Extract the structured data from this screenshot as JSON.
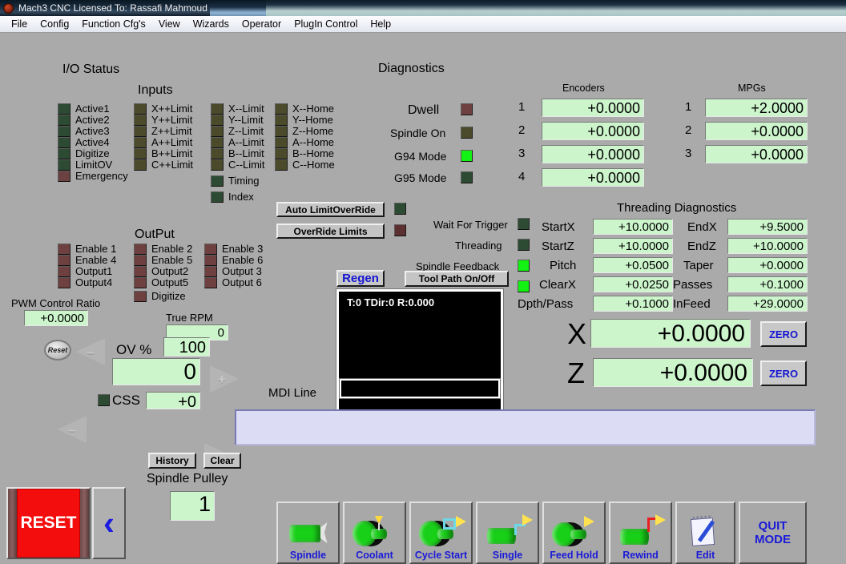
{
  "window": {
    "title": "Mach3 CNC  Licensed To: Rassafi Mahmoud",
    "icon": "mach3-logo-icon"
  },
  "menubar": {
    "items": [
      "File",
      "Config",
      "Function Cfg's",
      "View",
      "Wizards",
      "Operator",
      "PlugIn Control",
      "Help"
    ]
  },
  "io_status": {
    "title": "I/O Status",
    "inputs_title": "Inputs",
    "output_title": "OutPut",
    "inputs_col1": [
      {
        "label": "Active1",
        "state": "green-dark"
      },
      {
        "label": "Active2",
        "state": "green-dark"
      },
      {
        "label": "Active3",
        "state": "green-dark"
      },
      {
        "label": "Active4",
        "state": "green-dark"
      },
      {
        "label": "Digitize",
        "state": "green-dark"
      },
      {
        "label": "LimitOV",
        "state": "green-dark"
      },
      {
        "label": "Emergency",
        "state": "red-dark"
      }
    ],
    "inputs_col2": [
      {
        "label": "X++Limit",
        "state": "olive"
      },
      {
        "label": "Y++Limit",
        "state": "olive"
      },
      {
        "label": "Z++Limit",
        "state": "olive"
      },
      {
        "label": "A++Limit",
        "state": "olive"
      },
      {
        "label": "B++Limit",
        "state": "olive"
      },
      {
        "label": "C++Limit",
        "state": "olive"
      }
    ],
    "inputs_col3": [
      {
        "label": "X--Limit",
        "state": "olive"
      },
      {
        "label": "Y--Limit",
        "state": "olive"
      },
      {
        "label": "Z--Limit",
        "state": "olive"
      },
      {
        "label": "A--Limit",
        "state": "olive"
      },
      {
        "label": "B--Limit",
        "state": "olive"
      },
      {
        "label": "C--Limit",
        "state": "olive"
      }
    ],
    "inputs_col3_extra": [
      {
        "label": "Timing",
        "state": "green-dark"
      },
      {
        "label": "Index",
        "state": "green-dark"
      }
    ],
    "inputs_col4": [
      {
        "label": "X--Home",
        "state": "olive"
      },
      {
        "label": "Y--Home",
        "state": "olive"
      },
      {
        "label": "Z--Home",
        "state": "olive"
      },
      {
        "label": "A--Home",
        "state": "olive"
      },
      {
        "label": "B--Home",
        "state": "olive"
      },
      {
        "label": "C--Home",
        "state": "olive"
      }
    ],
    "output_col1": [
      {
        "label": "Enable 1",
        "state": "maroon"
      },
      {
        "label": "Enable 4",
        "state": "maroon"
      },
      {
        "label": "Output1",
        "state": "maroon"
      },
      {
        "label": "Output4",
        "state": "maroon"
      }
    ],
    "output_col2": [
      {
        "label": "Enable 2",
        "state": "maroon"
      },
      {
        "label": "Enable 5",
        "state": "maroon"
      },
      {
        "label": "Output2",
        "state": "maroon"
      },
      {
        "label": "Output5",
        "state": "maroon"
      },
      {
        "label": "Digitize",
        "state": "maroon"
      }
    ],
    "output_col3": [
      {
        "label": "Enable 3",
        "state": "maroon"
      },
      {
        "label": "Enable 6",
        "state": "maroon"
      },
      {
        "label": "Output 3",
        "state": "maroon"
      },
      {
        "label": "Output 6",
        "state": "maroon"
      }
    ]
  },
  "pwm": {
    "label": "PWM Control Ratio",
    "value": "+0.0000"
  },
  "true_rpm": {
    "label": "True RPM",
    "value": "0"
  },
  "override": {
    "reset_knob_label": "Reset",
    "ov_label": "OV %",
    "ov_value": "100",
    "feed_value": "0",
    "minus_sign": "–",
    "plus_sign": "+",
    "css_label": "CSS",
    "css_value": "+0",
    "css_led": "green-dark"
  },
  "diagnostics": {
    "title": "Diagnostics",
    "leds": [
      {
        "label": "Dwell",
        "state": "maroon"
      },
      {
        "label": "Spindle On",
        "state": "olive"
      },
      {
        "label": "G94 Mode",
        "state": "green-bright"
      },
      {
        "label": "G95 Mode",
        "state": "green-dark"
      }
    ],
    "auto_limit_override_button": "Auto LimitOverRide",
    "auto_limit_override_led": "green-dark",
    "override_limits_button": "OverRide Limits",
    "override_limits_led": "brown",
    "status_leds": [
      {
        "label": "Wait For Trigger",
        "state": "green-dark"
      },
      {
        "label": "Threading",
        "state": "green-dark"
      },
      {
        "label": "Spindle Feedback",
        "state": "green-bright"
      }
    ]
  },
  "toolpath": {
    "regen_button": "Regen",
    "toolpath_toggle_button": "Tool Path On/Off",
    "status_line": "T:0  TDir:0  R:0.000"
  },
  "mdi": {
    "label": "MDI Line",
    "value": "",
    "entry_value": ""
  },
  "encoders": {
    "title": "Encoders",
    "rows": [
      {
        "index": "1",
        "value": "+0.0000"
      },
      {
        "index": "2",
        "value": "+0.0000"
      },
      {
        "index": "3",
        "value": "+0.0000"
      },
      {
        "index": "4",
        "value": "+0.0000"
      }
    ]
  },
  "mpgs": {
    "title": "MPGs",
    "rows": [
      {
        "index": "1",
        "value": "+2.0000"
      },
      {
        "index": "2",
        "value": "+0.0000"
      },
      {
        "index": "3",
        "value": "+0.0000"
      }
    ]
  },
  "threading": {
    "title": "Threading Diagnostics",
    "left": [
      {
        "label": "StartX",
        "value": "+10.0000"
      },
      {
        "label": "StartZ",
        "value": "+10.0000"
      },
      {
        "label": "Pitch",
        "value": "+0.0500"
      },
      {
        "label": "ClearX",
        "value": "+0.0250"
      },
      {
        "label": "Dpth/Pass",
        "value": "+0.1000"
      }
    ],
    "right": [
      {
        "label": "EndX",
        "value": "+9.5000"
      },
      {
        "label": "EndZ",
        "value": "+10.0000"
      },
      {
        "label": "Taper",
        "value": "+0.0000"
      },
      {
        "label": "Passes",
        "value": "+0.1000"
      },
      {
        "label": "InFeed",
        "value": "+29.0000"
      }
    ]
  },
  "dro": {
    "axes": [
      {
        "label": "X",
        "value": "+0.0000",
        "zero_button": "ZERO"
      },
      {
        "label": "Z",
        "value": "+0.0000",
        "zero_button": "ZERO"
      }
    ]
  },
  "spindle_pulley": {
    "history_button": "History",
    "clear_button": "Clear",
    "label": "Spindle Pulley",
    "value": "1"
  },
  "reset": {
    "label": "RESET",
    "back_glyph": "‹"
  },
  "bottom_buttons": [
    {
      "label": "Spindle",
      "icon": "spindle-cylinder-icon"
    },
    {
      "label": "Coolant",
      "icon": "coolant-nozzle-icon"
    },
    {
      "label": "Cycle Start",
      "icon": "cycle-start-icon"
    },
    {
      "label": "Single",
      "icon": "single-step-icon"
    },
    {
      "label": "Feed Hold",
      "icon": "feed-hold-icon"
    },
    {
      "label": "Rewind",
      "icon": "rewind-icon"
    },
    {
      "label": "Edit",
      "icon": "notepad-pencil-icon"
    },
    {
      "label": "QUIT\nMODE",
      "icon": "quit-mode-icon"
    }
  ],
  "colors": {
    "background": "#aaaaaa",
    "dro_green": "#ccf5cc",
    "led_on_green": "#13f313",
    "reset_red": "#f40d0d",
    "button_blue_text": "#1a1ad8",
    "mdi_entry": "#dcdcf5"
  }
}
